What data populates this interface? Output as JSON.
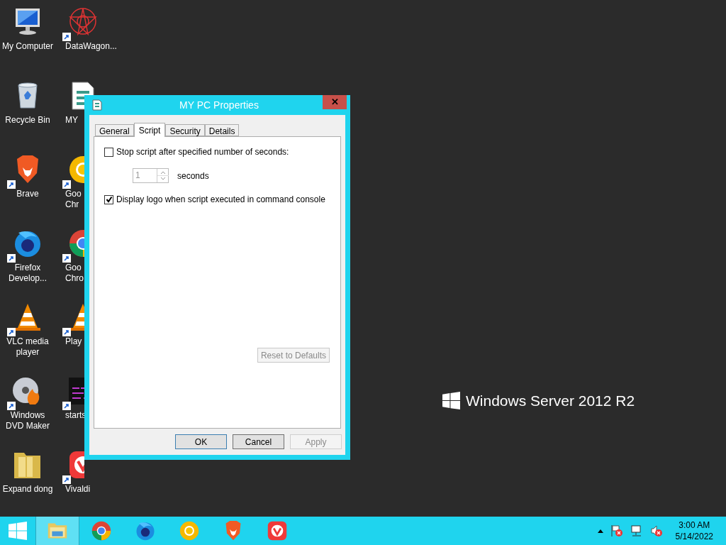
{
  "desktop_columns": [
    {
      "icons": [
        {
          "kind": "computer",
          "label": [
            "My Computer"
          ],
          "shortcut": false
        },
        {
          "kind": "bin",
          "label": [
            "Recycle Bin"
          ],
          "shortcut": false
        },
        {
          "kind": "lion",
          "label": [
            "Brave"
          ],
          "shortcut": true
        },
        {
          "kind": "fox",
          "label": [
            "Firefox",
            "Develop..."
          ],
          "shortcut": true
        },
        {
          "kind": "cone",
          "label": [
            "VLC media",
            "player"
          ],
          "shortcut": true
        },
        {
          "kind": "disc",
          "label": [
            "Windows",
            "DVD Maker"
          ],
          "shortcut": true
        },
        {
          "kind": "folder",
          "label": [
            "Expand dong"
          ],
          "shortcut": false
        }
      ]
    },
    {
      "icons": [
        {
          "kind": "star",
          "label": [
            "DataWagon..."
          ],
          "shortcut": true
        },
        {
          "kind": "script",
          "label": [
            "MY"
          ],
          "shortcut": false
        },
        {
          "kind": "ring",
          "label": [
            "Goo",
            "Chr"
          ],
          "shortcut": true
        },
        {
          "kind": "chrome",
          "label": [
            "Goo",
            "Chro"
          ],
          "shortcut": true
        },
        {
          "kind": "cone",
          "label": [
            "Play"
          ],
          "shortcut": true
        },
        {
          "kind": "terminal",
          "label": [
            "starts"
          ],
          "shortcut": true
        },
        {
          "kind": "vivaldi",
          "label": [
            "Vivaldi"
          ],
          "shortcut": true
        }
      ]
    }
  ],
  "branding": "Windows Server 2012 R2",
  "dialog": {
    "title": "MY PC Properties",
    "close": "✕",
    "tabs": [
      {
        "label": "General",
        "selected": false
      },
      {
        "label": "Script",
        "selected": true
      },
      {
        "label": "Security",
        "selected": false
      },
      {
        "label": "Details",
        "selected": false
      }
    ],
    "stop_script": {
      "label": "Stop script after specified number of seconds:",
      "checked": false
    },
    "seconds": {
      "value": "1",
      "unit": "seconds",
      "disabled": true
    },
    "display_logo": {
      "label": "Display logo when script executed in command console",
      "checked": true
    },
    "reset_button": {
      "label": "Reset to Defaults",
      "disabled": true
    },
    "buttons": [
      {
        "label": "OK",
        "default": true,
        "disabled": false
      },
      {
        "label": "Cancel",
        "default": false,
        "disabled": false
      },
      {
        "label": "Apply",
        "default": false,
        "disabled": true
      }
    ]
  },
  "taskbar": {
    "apps": [
      {
        "kind": "explorer",
        "selected": true
      },
      {
        "kind": "chrome",
        "selected": false
      },
      {
        "kind": "fox",
        "selected": false
      },
      {
        "kind": "ring",
        "selected": false
      },
      {
        "kind": "lion",
        "selected": false
      },
      {
        "kind": "vivaldi",
        "selected": false
      }
    ],
    "time": "3:00 AM",
    "date": "5/14/2022"
  }
}
